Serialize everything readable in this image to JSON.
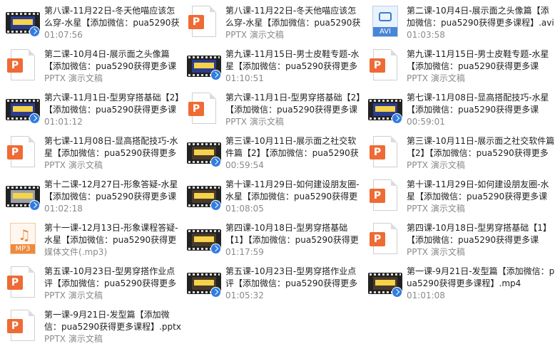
{
  "files": [
    {
      "name": "第八课-11月22日-冬天他喵应该怎么穿-水星【添加微信：pua5290获得更多课程】.mp4",
      "meta": "01:07:56",
      "icon": "video-file-icon",
      "frame": "blue"
    },
    {
      "name": "第八课-11月22日-冬天他喵应该怎么穿-水星【添加微信：pua5290获得更多课程】.pptx",
      "meta": "PPTX 演示文稿",
      "icon": "pptx-file-icon"
    },
    {
      "name": "第二课-10月4日-展示面之头像篇【添加微信：pua5290获得更多课程】.avi",
      "meta": "01:03:58",
      "icon": "avi-file-icon"
    },
    {
      "name": "第二课-10月4日-展示面之头像篇【添加微信：pua5290获得更多课程】.pptx",
      "meta": "PPTX 演示文稿",
      "icon": "pptx-file-icon"
    },
    {
      "name": "第九课-11月15日-男士皮鞋专题-水星【添加微信：pua5290获得更多课程】.mp4",
      "meta": "01:10:51",
      "icon": "video-file-icon",
      "frame": "blue"
    },
    {
      "name": "第九课-11月15日-男士皮鞋专题-水星【添加微信：pua5290获得更多课程】.pptx",
      "meta": "PPTX 演示文稿",
      "icon": "pptx-file-icon"
    },
    {
      "name": "第六课-11月1日-型男穿搭基础【2】【添加微信：pua5290获得更多课程】.mp4",
      "meta": "01:01:12",
      "icon": "video-file-icon",
      "frame": "blue"
    },
    {
      "name": "第六课-11月1日-型男穿搭基础【2】【添加微信：pua5290获得更多课程】.pptx",
      "meta": "PPTX 演示文稿",
      "icon": "pptx-file-icon"
    },
    {
      "name": "第七课-11月08日-显高搭配技巧-水星【添加微信：pua5290获得更多课程】.mp4",
      "meta": "00:59:01",
      "icon": "video-file-icon",
      "frame": "blue"
    },
    {
      "name": "第七课-11月08日-显高搭配技巧-水星【添加微信：pua5290获得更多课程】.pptx",
      "meta": "PPTX 演示文稿",
      "icon": "pptx-file-icon"
    },
    {
      "name": "第三课-10月11日-展示面之社交软件篇【2】【添加微信：pua5290获得更多课程】.mp4",
      "meta": "00:59:54",
      "icon": "video-file-icon",
      "frame": "dark"
    },
    {
      "name": "第三课-10月11日-展示面之社交软件篇【2】【添加微信：pua5290获得更多课程】.pptx",
      "meta": "PPTX 演示文稿",
      "icon": "pptx-file-icon"
    },
    {
      "name": "第十二课-12月27日-形象答疑-水星【添加微信：pua5290获得更多课程】.mp4",
      "meta": "01:02:18",
      "icon": "video-file-icon",
      "frame": "person"
    },
    {
      "name": "第十课-11月29日-如何建设朋友圈-水星【添加微信：pua5290获得更多课程】.mp4",
      "meta": "01:08:05",
      "icon": "video-file-icon",
      "frame": "dark"
    },
    {
      "name": "第十课-11月29日-如何建设朋友圈-水星【添加微信：pua5290获得更多课程】.pptx",
      "meta": "PPTX 演示文稿",
      "icon": "pptx-file-icon"
    },
    {
      "name": "第十一课-12月13日-形象课程答疑-水星【添加微信：pua5290获得更多课程】.mp3",
      "meta": "媒体文件(.mp3)",
      "icon": "mp3-file-icon"
    },
    {
      "name": "第四课-10月18日-型男穿搭基础【1】【添加微信：pua5290获得更多课程】.mp4",
      "meta": "01:17:59",
      "icon": "video-file-icon",
      "frame": "dark"
    },
    {
      "name": "第四课-10月18日-型男穿搭基础【1】【添加微信：pua5290获得更多课程】.pptx",
      "meta": "PPTX 演示文稿",
      "icon": "pptx-file-icon"
    },
    {
      "name": "第五课-10月23日-型男穿搭作业点评【添加微信：pua5290获得更多课程】.pptx",
      "meta": "PPTX 演示文稿",
      "icon": "pptx-file-icon"
    },
    {
      "name": "第五课-10月23日-型男穿搭作业点评【添加微信：pua5290获得更多课程】.mp4",
      "meta": "01:05:32",
      "icon": "video-file-icon",
      "frame": "dark"
    },
    {
      "name": "第一课-9月21日-发型篇【添加微信：pua5290获得更多课程】.mp4",
      "meta": "01:01:08",
      "icon": "video-file-icon",
      "frame": "dark"
    },
    {
      "name": "第一课-9月21日-发型篇【添加微信：pua5290获得更多课程】.pptx",
      "meta": "PPTX 演示文稿",
      "icon": "pptx-file-icon"
    }
  ],
  "labels": {
    "avi": "AVI",
    "mp3": "MP3",
    "ppt_letter": "P",
    "note": "♫"
  },
  "colors": {
    "pptx": "#ee6b35",
    "accent": "#2f7de1",
    "meta_text": "#8a8a8a"
  }
}
